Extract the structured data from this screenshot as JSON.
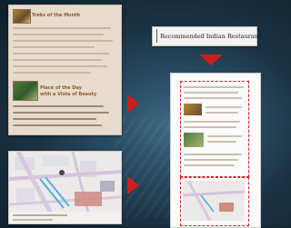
{
  "top_card": {
    "title1": "Treks of the Month",
    "title2_line1": "Place of the Day",
    "title2_line2": "with a Vista of Beauty"
  },
  "search_bar": {
    "text": "Recommended Indian Restaurant"
  },
  "colors": {
    "accent_red": "#d11c1c",
    "title_brown": "#8b5a2b"
  },
  "icons": {
    "arrow1": "red-right-arrow",
    "arrow2": "red-right-arrow",
    "arrow3": "red-down-arrow"
  }
}
